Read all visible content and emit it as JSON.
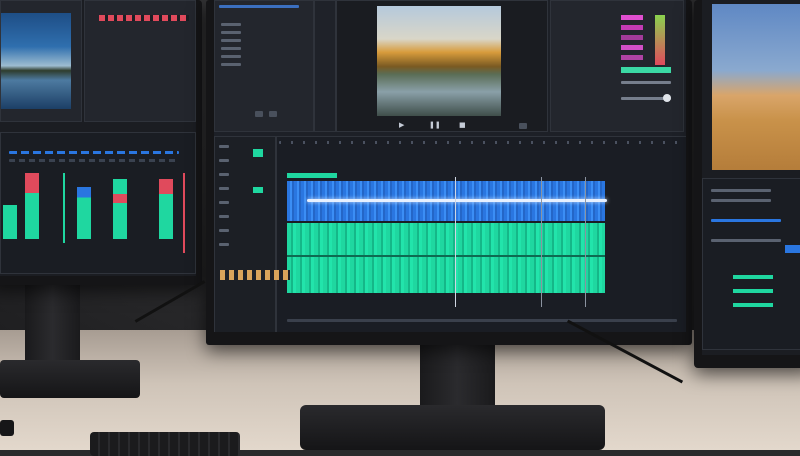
{
  "scene": {
    "description_tags": [
      "dual-monitor",
      "video-editing",
      "timeline",
      "desk"
    ]
  },
  "left_monitor": {
    "preview_icon": "lake-thumbnail",
    "meter_colors": [
      "#1fd7a0",
      "#e04a5c",
      "#2a76e0"
    ]
  },
  "center_monitor": {
    "preview_icon": "autumn-lake-thumbnail",
    "playback_icons": [
      "play-icon",
      "pause-icon",
      "stop-icon"
    ],
    "timeline": {
      "tracks": [
        {
          "type": "video",
          "color": "#2a76e0"
        },
        {
          "type": "audio",
          "color": "#1fd7a0"
        }
      ]
    },
    "color_bars": [
      "#e04fd0",
      "#c43bb5",
      "#a33b9a",
      "#8ad24e",
      "#3bd9a4"
    ]
  },
  "right_monitor": {
    "preview_icon": "beach-sunset-thumbnail"
  },
  "colors": {
    "accent_blue": "#2a76e0",
    "accent_green": "#1fd7a0",
    "accent_magenta": "#e04fd0",
    "accent_red": "#e04a5c"
  }
}
